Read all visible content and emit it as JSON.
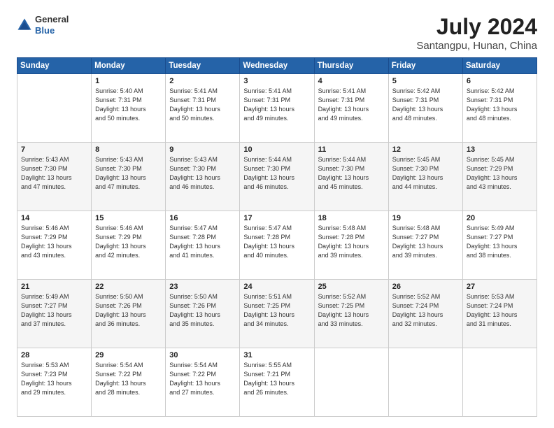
{
  "logo": {
    "general": "General",
    "blue": "Blue"
  },
  "title": "July 2024",
  "subtitle": "Santangpu, Hunan, China",
  "days_of_week": [
    "Sunday",
    "Monday",
    "Tuesday",
    "Wednesday",
    "Thursday",
    "Friday",
    "Saturday"
  ],
  "weeks": [
    [
      {
        "day": "",
        "info": ""
      },
      {
        "day": "1",
        "info": "Sunrise: 5:40 AM\nSunset: 7:31 PM\nDaylight: 13 hours\nand 50 minutes."
      },
      {
        "day": "2",
        "info": "Sunrise: 5:41 AM\nSunset: 7:31 PM\nDaylight: 13 hours\nand 50 minutes."
      },
      {
        "day": "3",
        "info": "Sunrise: 5:41 AM\nSunset: 7:31 PM\nDaylight: 13 hours\nand 49 minutes."
      },
      {
        "day": "4",
        "info": "Sunrise: 5:41 AM\nSunset: 7:31 PM\nDaylight: 13 hours\nand 49 minutes."
      },
      {
        "day": "5",
        "info": "Sunrise: 5:42 AM\nSunset: 7:31 PM\nDaylight: 13 hours\nand 48 minutes."
      },
      {
        "day": "6",
        "info": "Sunrise: 5:42 AM\nSunset: 7:31 PM\nDaylight: 13 hours\nand 48 minutes."
      }
    ],
    [
      {
        "day": "7",
        "info": "Sunrise: 5:43 AM\nSunset: 7:30 PM\nDaylight: 13 hours\nand 47 minutes."
      },
      {
        "day": "8",
        "info": "Sunrise: 5:43 AM\nSunset: 7:30 PM\nDaylight: 13 hours\nand 47 minutes."
      },
      {
        "day": "9",
        "info": "Sunrise: 5:43 AM\nSunset: 7:30 PM\nDaylight: 13 hours\nand 46 minutes."
      },
      {
        "day": "10",
        "info": "Sunrise: 5:44 AM\nSunset: 7:30 PM\nDaylight: 13 hours\nand 46 minutes."
      },
      {
        "day": "11",
        "info": "Sunrise: 5:44 AM\nSunset: 7:30 PM\nDaylight: 13 hours\nand 45 minutes."
      },
      {
        "day": "12",
        "info": "Sunrise: 5:45 AM\nSunset: 7:30 PM\nDaylight: 13 hours\nand 44 minutes."
      },
      {
        "day": "13",
        "info": "Sunrise: 5:45 AM\nSunset: 7:29 PM\nDaylight: 13 hours\nand 43 minutes."
      }
    ],
    [
      {
        "day": "14",
        "info": "Sunrise: 5:46 AM\nSunset: 7:29 PM\nDaylight: 13 hours\nand 43 minutes."
      },
      {
        "day": "15",
        "info": "Sunrise: 5:46 AM\nSunset: 7:29 PM\nDaylight: 13 hours\nand 42 minutes."
      },
      {
        "day": "16",
        "info": "Sunrise: 5:47 AM\nSunset: 7:28 PM\nDaylight: 13 hours\nand 41 minutes."
      },
      {
        "day": "17",
        "info": "Sunrise: 5:47 AM\nSunset: 7:28 PM\nDaylight: 13 hours\nand 40 minutes."
      },
      {
        "day": "18",
        "info": "Sunrise: 5:48 AM\nSunset: 7:28 PM\nDaylight: 13 hours\nand 39 minutes."
      },
      {
        "day": "19",
        "info": "Sunrise: 5:48 AM\nSunset: 7:27 PM\nDaylight: 13 hours\nand 39 minutes."
      },
      {
        "day": "20",
        "info": "Sunrise: 5:49 AM\nSunset: 7:27 PM\nDaylight: 13 hours\nand 38 minutes."
      }
    ],
    [
      {
        "day": "21",
        "info": "Sunrise: 5:49 AM\nSunset: 7:27 PM\nDaylight: 13 hours\nand 37 minutes."
      },
      {
        "day": "22",
        "info": "Sunrise: 5:50 AM\nSunset: 7:26 PM\nDaylight: 13 hours\nand 36 minutes."
      },
      {
        "day": "23",
        "info": "Sunrise: 5:50 AM\nSunset: 7:26 PM\nDaylight: 13 hours\nand 35 minutes."
      },
      {
        "day": "24",
        "info": "Sunrise: 5:51 AM\nSunset: 7:25 PM\nDaylight: 13 hours\nand 34 minutes."
      },
      {
        "day": "25",
        "info": "Sunrise: 5:52 AM\nSunset: 7:25 PM\nDaylight: 13 hours\nand 33 minutes."
      },
      {
        "day": "26",
        "info": "Sunrise: 5:52 AM\nSunset: 7:24 PM\nDaylight: 13 hours\nand 32 minutes."
      },
      {
        "day": "27",
        "info": "Sunrise: 5:53 AM\nSunset: 7:24 PM\nDaylight: 13 hours\nand 31 minutes."
      }
    ],
    [
      {
        "day": "28",
        "info": "Sunrise: 5:53 AM\nSunset: 7:23 PM\nDaylight: 13 hours\nand 29 minutes."
      },
      {
        "day": "29",
        "info": "Sunrise: 5:54 AM\nSunset: 7:22 PM\nDaylight: 13 hours\nand 28 minutes."
      },
      {
        "day": "30",
        "info": "Sunrise: 5:54 AM\nSunset: 7:22 PM\nDaylight: 13 hours\nand 27 minutes."
      },
      {
        "day": "31",
        "info": "Sunrise: 5:55 AM\nSunset: 7:21 PM\nDaylight: 13 hours\nand 26 minutes."
      },
      {
        "day": "",
        "info": ""
      },
      {
        "day": "",
        "info": ""
      },
      {
        "day": "",
        "info": ""
      }
    ]
  ]
}
